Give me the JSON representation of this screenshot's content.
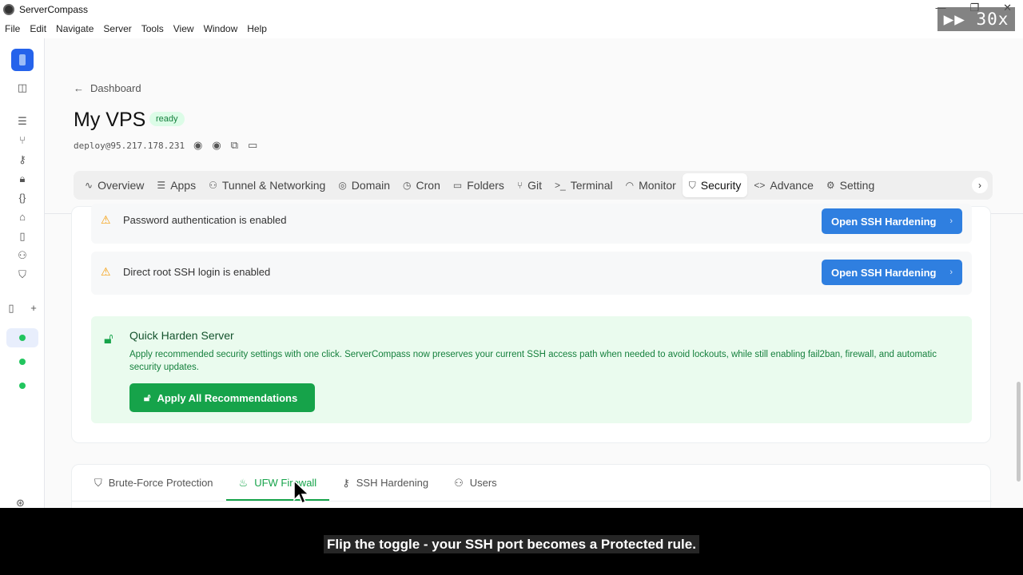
{
  "window": {
    "title": "ServerCompass",
    "speed": "▶▶ 30x"
  },
  "menu": [
    "File",
    "Edit",
    "Navigate",
    "Server",
    "Tools",
    "View",
    "Window",
    "Help"
  ],
  "header": {
    "back_label": "Dashboard",
    "server_name": "My VPS",
    "status": "ready",
    "host": "deploy@95.217.178.231"
  },
  "tabs": [
    {
      "label": "Overview",
      "icon": "∿"
    },
    {
      "label": "Apps",
      "icon": "☰"
    },
    {
      "label": "Tunnel & Networking",
      "icon": "⚇"
    },
    {
      "label": "Domain",
      "icon": "◎"
    },
    {
      "label": "Cron",
      "icon": "◷"
    },
    {
      "label": "Folders",
      "icon": "▭"
    },
    {
      "label": "Git",
      "icon": "⑂"
    },
    {
      "label": "Terminal",
      "icon": ">_"
    },
    {
      "label": "Monitor",
      "icon": "◠"
    },
    {
      "label": "Security",
      "icon": "⛉"
    },
    {
      "label": "Advance",
      "icon": "<>"
    },
    {
      "label": "Setting",
      "icon": "⚙"
    }
  ],
  "issues": [
    {
      "text": "Password authentication is enabled",
      "button": "Open SSH Hardening"
    },
    {
      "text": "Direct root SSH login is enabled",
      "button": "Open SSH Hardening"
    }
  ],
  "harden": {
    "title": "Quick Harden Server",
    "description": "Apply recommended security settings with one click. ServerCompass now preserves your current SSH access path when needed to avoid lockouts, while still enabling fail2ban, firewall, and automatic security updates.",
    "button": "Apply All Recommendations"
  },
  "subtabs": [
    {
      "label": "Brute-Force Protection",
      "icon": "⛉"
    },
    {
      "label": "UFW Firewall",
      "icon": "♨"
    },
    {
      "label": "SSH Hardening",
      "icon": "⚷"
    },
    {
      "label": "Users",
      "icon": "⚇"
    }
  ],
  "caption": "Flip the toggle - your SSH port becomes a Protected rule.",
  "colors": {
    "primary_blue": "#2f7fe0",
    "success_green": "#16a34a",
    "warning": "#f59e0b"
  }
}
